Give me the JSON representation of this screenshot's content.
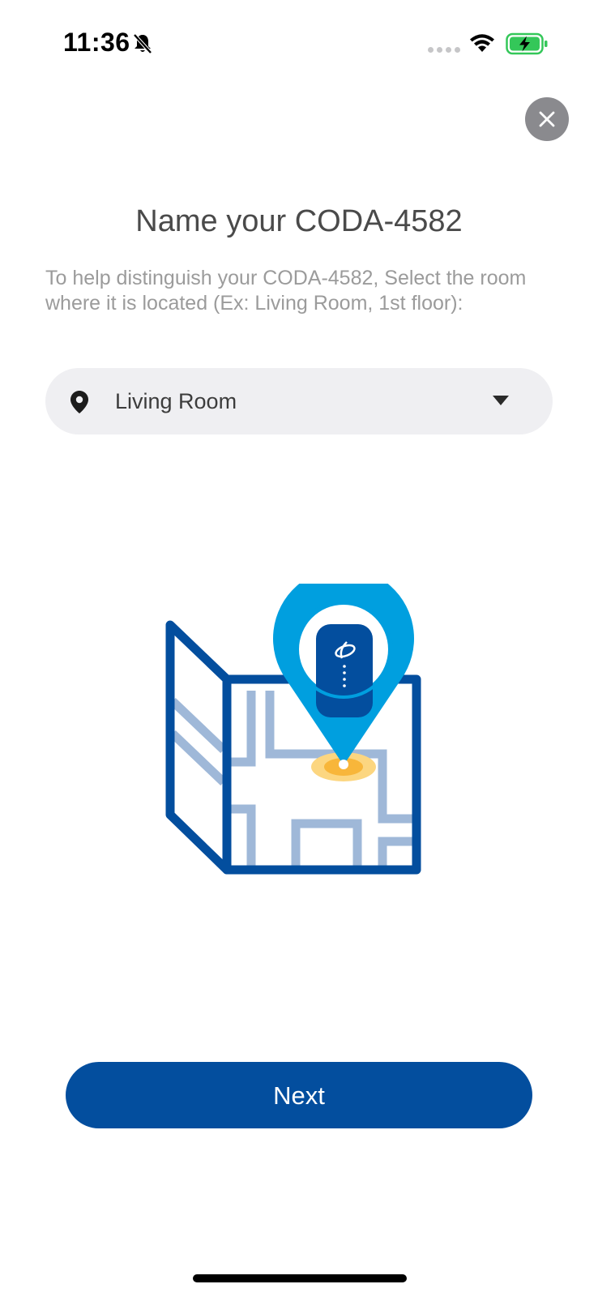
{
  "status_bar": {
    "time": "11:36",
    "icons": [
      "bell-slash-icon",
      "cellular-signal-icon",
      "wifi-icon",
      "battery-charging-icon"
    ]
  },
  "header": {
    "close_icon": "close-icon"
  },
  "main": {
    "title": "Name your CODA-4582",
    "subtitle": "To help distinguish your CODA-4582, Select the room where it is located (Ex: Living Room, 1st floor):",
    "room_select": {
      "value": "Living Room",
      "icon": "location-pin-icon",
      "caret_icon": "caret-down-icon"
    },
    "illustration_icon": "map-with-location-pin-icon"
  },
  "footer": {
    "next_label": "Next"
  },
  "colors": {
    "primary": "#034e9e",
    "accent": "#009fdf",
    "highlight": "#fbbf24",
    "close_bg": "#8a8a8e",
    "select_bg": "#efeff2",
    "title": "#4a4a4a",
    "subtitle": "#9b9b9b",
    "battery": "#34c759"
  }
}
